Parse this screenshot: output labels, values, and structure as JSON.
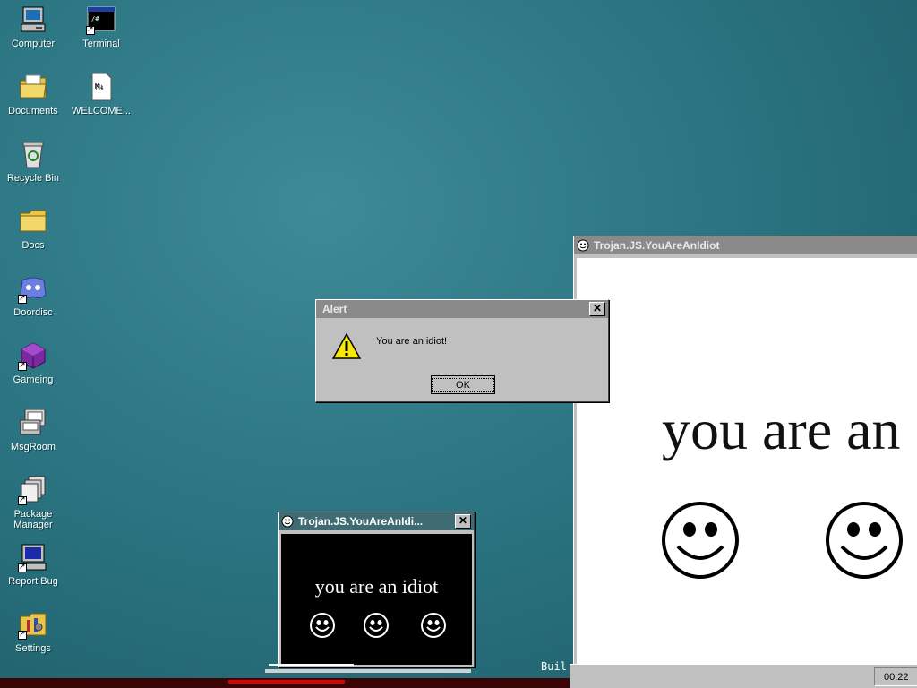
{
  "desktop": {
    "icons": [
      {
        "label": "Computer",
        "icon": "computer-icon"
      },
      {
        "label": "Terminal",
        "icon": "terminal-icon"
      },
      {
        "label": "Documents",
        "icon": "documents-folder-icon"
      },
      {
        "label": "WELCOME...",
        "icon": "document-file-icon"
      },
      {
        "label": "Recycle Bin",
        "icon": "recycle-bin-icon"
      },
      {
        "label": "Docs",
        "icon": "folder-icon"
      },
      {
        "label": "Doordisc",
        "icon": "doordisc-icon"
      },
      {
        "label": "Gameing",
        "icon": "game-cube-icon"
      },
      {
        "label": "MsgRoom",
        "icon": "msgroom-icon"
      },
      {
        "label": "Package Manager",
        "icon": "package-manager-icon"
      },
      {
        "label": "Report Bug",
        "icon": "report-bug-icon"
      },
      {
        "label": "Settings",
        "icon": "settings-icon"
      }
    ]
  },
  "big_window": {
    "title": "Trojan.JS.YouAreAnIdiot",
    "text": "you are an"
  },
  "alert": {
    "title": "Alert",
    "message": "You are an idiot!",
    "ok_label": "OK"
  },
  "small_window": {
    "title": "Trojan.JS.YouAreAnIdi...",
    "text": "you are an idiot"
  },
  "taskbar": {
    "clock": "00:22",
    "build_text": "Buil"
  },
  "colors": {
    "desktop": "#2e7886",
    "active_title": "#3f6b73",
    "inactive_title": "#8a8a8a"
  }
}
